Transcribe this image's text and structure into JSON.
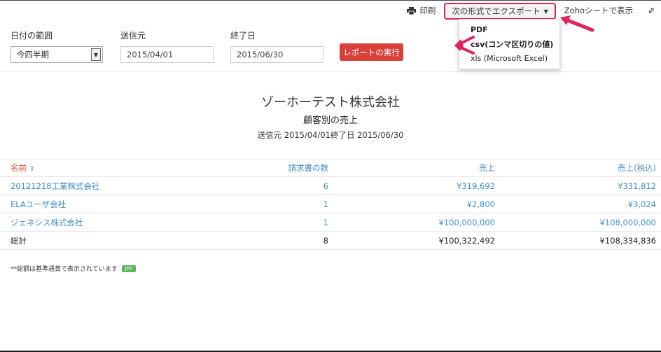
{
  "toolbar": {
    "print_label": "印刷",
    "export_label": "次の形式でエクスポート",
    "zoho_label": "Zohoシートで表示"
  },
  "export_menu": {
    "items": [
      "PDF",
      "csv(コンマ区切りの値)",
      "xls (Microsoft Excel)"
    ]
  },
  "filters": {
    "date_range_label": "日付の範囲",
    "date_range_value": "今四半期",
    "from_label": "送信元",
    "from_value": "2015/04/01",
    "to_label": "終了日",
    "to_value": "2015/06/30",
    "run_label": "レポートの実行"
  },
  "report": {
    "company": "ゾーホーテスト株式会社",
    "title": "顧客別の売上",
    "period": "送信元 2015/04/01終了日 2015/06/30"
  },
  "table": {
    "headers": [
      "名前",
      "請求書の数",
      "売上",
      "売上(税込)"
    ],
    "rows": [
      [
        "20121218工業株式会社",
        "6",
        "¥319,692",
        "¥331,812"
      ],
      [
        "ELAユーザ会社",
        "1",
        "¥2,800",
        "¥3,024"
      ],
      [
        "ジェネシス株式会社",
        "1",
        "¥100,000,000",
        "¥108,000,000"
      ]
    ],
    "total": [
      "総計",
      "8",
      "¥100,322,492",
      "¥108,334,836"
    ]
  },
  "footnote": {
    "text": "**総額は基準通貨で表示されています",
    "currency": "JPY"
  },
  "colors": {
    "accent_red": "#d9403a",
    "highlight": "#e0245e",
    "link_blue": "#408dc9",
    "badge_green": "#5cb85c"
  }
}
